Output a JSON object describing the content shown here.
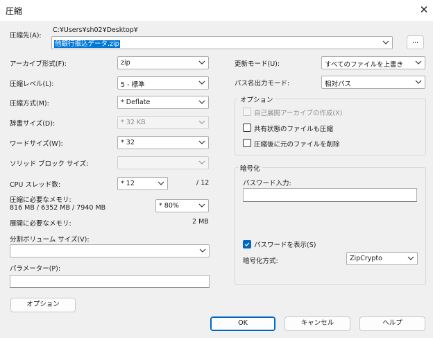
{
  "window": {
    "title": "圧縮",
    "close": "✕"
  },
  "destination": {
    "label": "圧縮先(A):",
    "path": "C:¥Users¥sh02¥Desktop¥",
    "filename": "他銀行振込データ.zip",
    "browse_label": "..."
  },
  "left": {
    "archive_format": {
      "label": "アーカイブ形式(F):",
      "value": "zip"
    },
    "level": {
      "label": "圧縮レベル(L):",
      "value": "5 - 標準"
    },
    "method": {
      "label": "圧縮方式(M):",
      "value": "* Deflate"
    },
    "dict": {
      "label": "辞書サイズ(D):",
      "value": "* 32 KB"
    },
    "word": {
      "label": "ワードサイズ(W):",
      "value": "* 32"
    },
    "solid": {
      "label": "ソリッド ブロック サイズ:",
      "value": ""
    },
    "threads": {
      "label": "CPU スレッド数:",
      "value": "* 12",
      "total": "/ 12"
    },
    "memory": {
      "label": "圧縮に必要なメモリ:",
      "detail": "816 MB / 6352 MB / 7940 MB",
      "value": "* 80%"
    },
    "decomp_memory": {
      "label": "展開に必要なメモリ:",
      "value": "2 MB"
    },
    "split": {
      "label": "分割ボリューム サイズ(V):",
      "value": ""
    },
    "params": {
      "label": "パラメーター(P):",
      "value": ""
    },
    "options_button": "オプション"
  },
  "right": {
    "update_mode": {
      "label": "更新モード(U):",
      "value": "すべてのファイルを上書き"
    },
    "path_mode": {
      "label": "パス名出力モード:",
      "value": "相対パス"
    },
    "options_group": {
      "title": "オプション",
      "sfx": {
        "label": "自己展開アーカイブの作成(X)",
        "checked": false,
        "disabled": true
      },
      "shared": {
        "label": "共有状態のファイルも圧縮",
        "checked": false
      },
      "delete": {
        "label": "圧縮後に元のファイルを削除",
        "checked": false
      }
    },
    "encryption": {
      "title": "暗号化",
      "password_label": "パスワード入力:",
      "password_value": "",
      "show_password": {
        "label": "パスワードを表示(S)",
        "checked": true
      },
      "method_label": "暗号化方式:",
      "method_value": "ZipCrypto"
    }
  },
  "buttons": {
    "ok": "OK",
    "cancel": "キャンセル",
    "help": "ヘルプ"
  }
}
